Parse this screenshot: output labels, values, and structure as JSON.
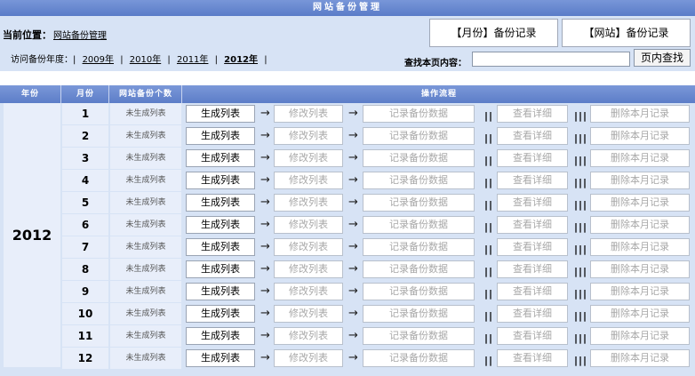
{
  "title": "网站备份管理",
  "location": {
    "label": "当前位置：",
    "link": "网站备份管理"
  },
  "record_buttons": {
    "month": "【月份】备份记录",
    "site": "【网站】备份记录"
  },
  "years": {
    "label": "访问备份年度：|",
    "items": [
      "2009年",
      "2010年",
      "2011年",
      "2012年"
    ],
    "separator": "|",
    "active": "2012年"
  },
  "search": {
    "label": "查找本页内容：",
    "button": "页内查找",
    "value": ""
  },
  "table": {
    "headers": {
      "year": "年份",
      "month": "月份",
      "count": "网站备份个数",
      "ops": "操作流程"
    },
    "year": "2012",
    "rows": [
      {
        "month": "1",
        "count": "未生成列表"
      },
      {
        "month": "2",
        "count": "未生成列表"
      },
      {
        "month": "3",
        "count": "未生成列表"
      },
      {
        "month": "4",
        "count": "未生成列表"
      },
      {
        "month": "5",
        "count": "未生成列表"
      },
      {
        "month": "6",
        "count": "未生成列表"
      },
      {
        "month": "7",
        "count": "未生成列表"
      },
      {
        "month": "8",
        "count": "未生成列表"
      },
      {
        "month": "9",
        "count": "未生成列表"
      },
      {
        "month": "10",
        "count": "未生成列表"
      },
      {
        "month": "11",
        "count": "未生成列表"
      },
      {
        "month": "12",
        "count": "未生成列表"
      }
    ],
    "ops": {
      "generate": "生成列表",
      "modify": "修改列表",
      "record": "记录备份数据",
      "view": "查看详细",
      "delete": "删除本月记录",
      "arrow": "→",
      "bar2": "||",
      "bar3": "|||"
    }
  }
}
